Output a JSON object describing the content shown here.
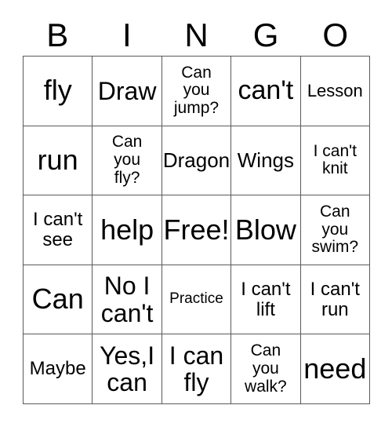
{
  "card": {
    "title": "BINGO",
    "header_letters": [
      "B",
      "I",
      "N",
      "G",
      "O"
    ],
    "free_space_label": "Free!",
    "grid": {
      "columns": 5,
      "rows": 5,
      "cells": [
        {
          "text": "fly",
          "size": "fs-xl",
          "free": false
        },
        {
          "text": "Draw",
          "size": "fs-md",
          "free": false
        },
        {
          "text": "Can\nyou\njump?",
          "size": "fs-3xs",
          "free": false
        },
        {
          "text": "can't",
          "size": "fs-lg",
          "free": false
        },
        {
          "text": "Lesson",
          "size": "fs-2xs",
          "free": false
        },
        {
          "text": "run",
          "size": "fs-xl",
          "free": false
        },
        {
          "text": "Can\nyou\nfly?",
          "size": "fs-3xs",
          "free": false
        },
        {
          "text": "Dragon",
          "size": "fs-sm",
          "free": false
        },
        {
          "text": "Wings",
          "size": "fs-sm",
          "free": false
        },
        {
          "text": "I can't\nknit",
          "size": "fs-3xs",
          "free": false
        },
        {
          "text": "I can't\nsee",
          "size": "fs-xs",
          "free": false
        },
        {
          "text": "help",
          "size": "fs-xl",
          "free": false
        },
        {
          "text": "Free!",
          "size": "fs-xl",
          "free": true
        },
        {
          "text": "Blow",
          "size": "fs-xl",
          "free": false
        },
        {
          "text": "Can\nyou\nswim?",
          "size": "fs-3xs",
          "free": false
        },
        {
          "text": "Can",
          "size": "fs-xl",
          "free": false
        },
        {
          "text": "No I\ncan't",
          "size": "fs-md",
          "free": false
        },
        {
          "text": "Practice",
          "size": "fs-4xs",
          "free": false
        },
        {
          "text": "I can't\nlift",
          "size": "fs-xs",
          "free": false
        },
        {
          "text": "I can't\nrun",
          "size": "fs-xs",
          "free": false
        },
        {
          "text": "Maybe",
          "size": "fs-xs",
          "free": false
        },
        {
          "text": "Yes,I\ncan",
          "size": "fs-md",
          "free": false
        },
        {
          "text": "I can\nfly",
          "size": "fs-md",
          "free": false
        },
        {
          "text": "Can\nyou\nwalk?",
          "size": "fs-3xs",
          "free": false
        },
        {
          "text": "need",
          "size": "fs-xl",
          "free": false
        }
      ]
    }
  },
  "colors": {
    "background": "#ffffff",
    "text": "#000000",
    "grid_line": "#5a5a5a"
  }
}
